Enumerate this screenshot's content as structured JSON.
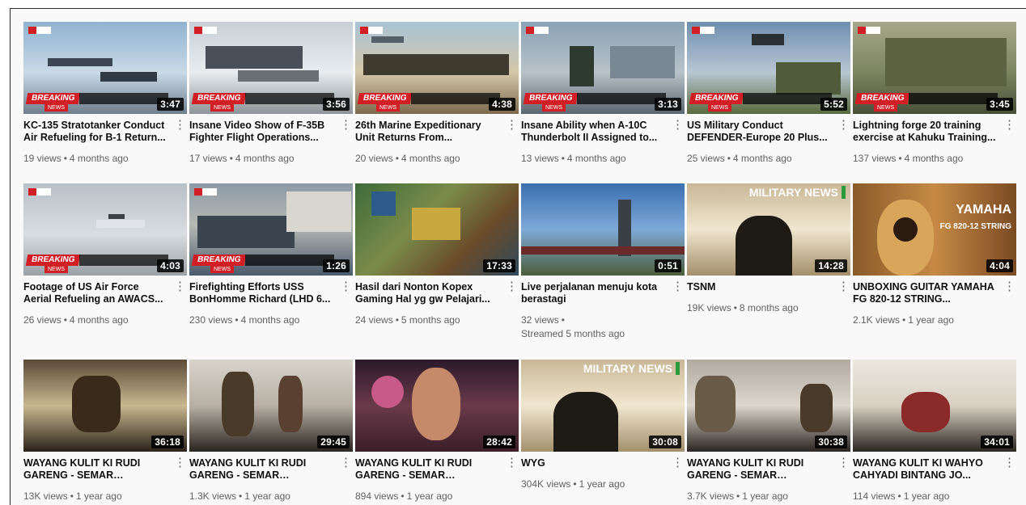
{
  "videos": [
    {
      "title": "KC-135 Stratotanker Conduct Air Refueling for B-1 Return...",
      "views": "19 views",
      "age": "4 months ago",
      "duration": "3:47",
      "breaking": "BREAKING",
      "news": "NEWS"
    },
    {
      "title": "Insane Video Show of F-35B Fighter Flight Operations...",
      "views": "17 views",
      "age": "4 months ago",
      "duration": "3:56",
      "breaking": "BREAKING",
      "news": "NEWS"
    },
    {
      "title": "26th Marine Expeditionary Unit Returns From...",
      "views": "20 views",
      "age": "4 months ago",
      "duration": "4:38",
      "breaking": "BREAKING",
      "news": "NEWS"
    },
    {
      "title": "Insane Ability when A-10C Thunderbolt II Assigned to...",
      "views": "13 views",
      "age": "4 months ago",
      "duration": "3:13",
      "breaking": "BREAKING",
      "news": "NEWS"
    },
    {
      "title": "US Military Conduct DEFENDER-Europe 20 Plus...",
      "views": "25 views",
      "age": "4 months ago",
      "duration": "5:52",
      "breaking": "BREAKING",
      "news": "NEWS"
    },
    {
      "title": "Lightning forge 20 training exercise at Kahuku Training...",
      "views": "137 views",
      "age": "4 months ago",
      "duration": "3:45",
      "breaking": "BREAKING",
      "news": "NEWS"
    },
    {
      "title": "Footage of US Air Force Aerial Refueling an AWACS...",
      "views": "26 views",
      "age": "4 months ago",
      "duration": "4:03",
      "breaking": "BREAKING",
      "news": "NEWS"
    },
    {
      "title": "Firefighting Efforts USS BonHomme Richard (LHD 6...",
      "views": "230 views",
      "age": "4 months ago",
      "duration": "1:26",
      "breaking": "BREAKING",
      "news": "NEWS"
    },
    {
      "title": "Hasil dari Nonton Kopex Gaming Hal yg gw Pelajari...",
      "views": "24 views",
      "age": "5 months ago",
      "duration": "17:33"
    },
    {
      "title": "Live perjalanan menuju kota berastagi",
      "views": "32 views",
      "age": "Streamed 5 months ago",
      "duration": "0:51"
    },
    {
      "title": "TSNM",
      "views": "19K views",
      "age": "8 months ago",
      "duration": "14:28",
      "overlay": "MILITARY NEWS"
    },
    {
      "title": "UNBOXING GUITAR YAMAHA FG 820-12 STRING...",
      "views": "2.1K views",
      "age": "1 year ago",
      "duration": "4:04",
      "overlay": "YAMAHA",
      "overlay2": "FG 820-12 STRING"
    },
    {
      "title": "WAYANG KULIT KI RUDI GARENG - SEMAR MBANGU...",
      "views": "13K views",
      "age": "1 year ago",
      "duration": "36:18"
    },
    {
      "title": "WAYANG KULIT KI RUDI GARENG - SEMAR MBANGU...",
      "views": "1.3K views",
      "age": "1 year ago",
      "duration": "29:45"
    },
    {
      "title": "WAYANG KULIT KI RUDI GARENG - SEMAR MBANGU...",
      "views": "894 views",
      "age": "1 year ago",
      "duration": "28:42"
    },
    {
      "title": "WYG",
      "views": "304K views",
      "age": "1 year ago",
      "duration": "30:08",
      "overlay": "MILITARY NEWS"
    },
    {
      "title": "WAYANG KULIT KI RUDI GARENG - SEMAR MBANGU...",
      "views": "3.7K views",
      "age": "1 year ago",
      "duration": "30:38"
    },
    {
      "title": "WAYANG KULIT KI WAHYO CAHYADI BINTANG JO...",
      "views": "114 views",
      "age": "1 year ago",
      "duration": "34:01"
    }
  ],
  "separator": "•",
  "menu_glyph": "⋮"
}
